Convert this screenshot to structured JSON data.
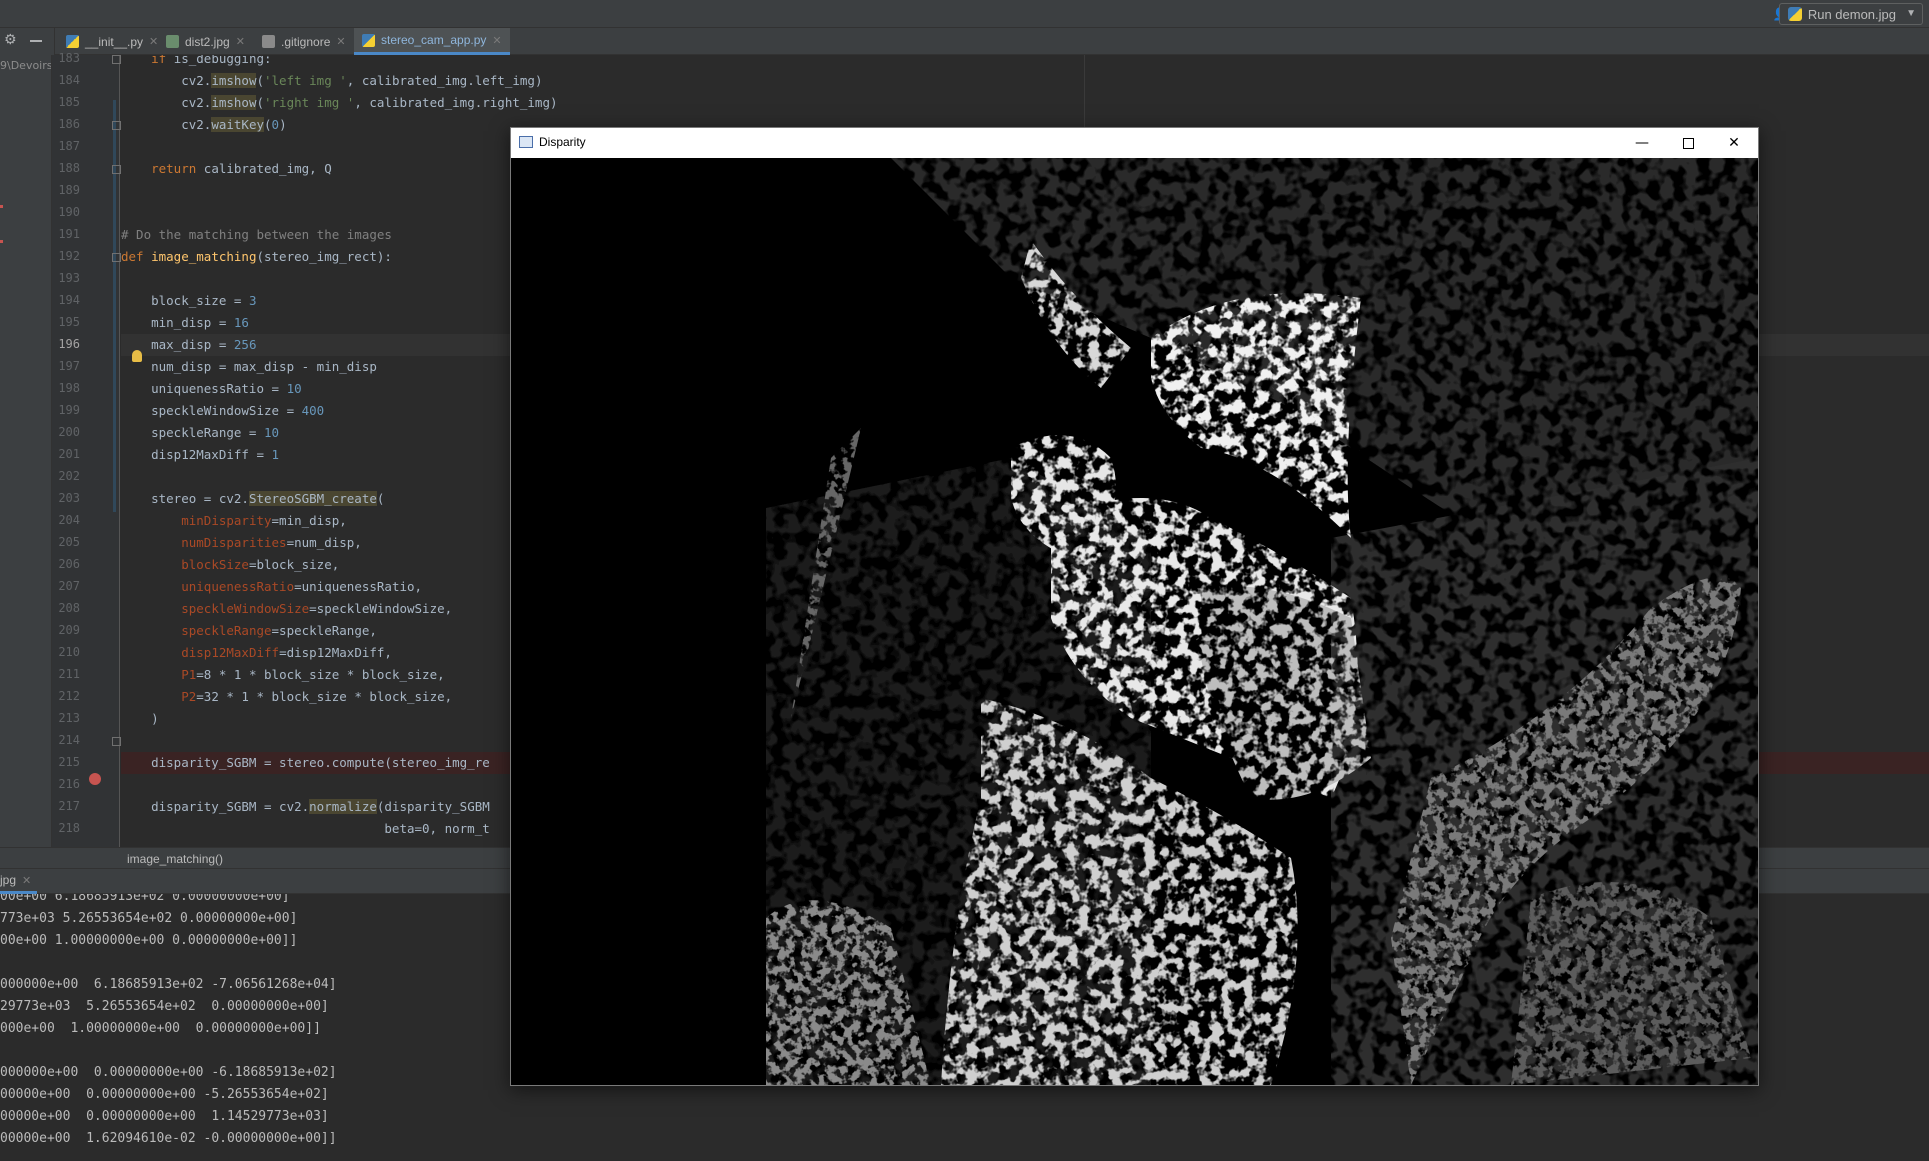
{
  "toolbar": {
    "run_config_label": "Run demon.jpg"
  },
  "tabs": [
    {
      "label": "__init__.py",
      "icon": "python-file-icon"
    },
    {
      "label": "dist2.jpg",
      "icon": "image-file-icon"
    },
    {
      "label": ".gitignore",
      "icon": "text-file-icon"
    },
    {
      "label": "stereo_cam_app.py",
      "icon": "python-file-icon",
      "active": true
    }
  ],
  "project_path_fragment": "9\\Devoirs",
  "editor": {
    "line_numbers": [
      "183",
      "184",
      "185",
      "186",
      "187",
      "188",
      "189",
      "190",
      "191",
      "192",
      "193",
      "194",
      "195",
      "196",
      "197",
      "198",
      "199",
      "200",
      "201",
      "202",
      "203",
      "204",
      "205",
      "206",
      "207",
      "208",
      "209",
      "210",
      "211",
      "212",
      "213",
      "214",
      "215",
      "216",
      "217",
      "218"
    ],
    "current_line": "196",
    "breakpoint_line": "215",
    "code_lines": [
      "    if is_debugging:",
      "        cv2.imshow('left img ', calibrated_img.left_img)",
      "        cv2.imshow('right img ', calibrated_img.right_img)",
      "        cv2.waitKey(0)",
      "",
      "    return calibrated_img, Q",
      "",
      "",
      "# Do the matching between the images",
      "def image_matching(stereo_img_rect):",
      "",
      "    block_size = 3",
      "    min_disp = 16",
      "    max_disp = 256",
      "    num_disp = max_disp - min_disp",
      "    uniquenessRatio = 10",
      "    speckleWindowSize = 400",
      "    speckleRange = 10",
      "    disp12MaxDiff = 1",
      "",
      "    stereo = cv2.StereoSGBM_create(",
      "        minDisparity=min_disp,",
      "        numDisparities=num_disp,",
      "        blockSize=block_size,",
      "        uniquenessRatio=uniquenessRatio,",
      "        speckleWindowSize=speckleWindowSize,",
      "        speckleRange=speckleRange,",
      "        disp12MaxDiff=disp12MaxDiff,",
      "        P1=8 * 1 * block_size * block_size,",
      "        P2=32 * 1 * block_size * block_size,",
      "    )",
      "",
      "    disparity_SGBM = stereo.compute(stereo_img_re",
      "",
      "    disparity_SGBM = cv2.normalize(disparity_SGBM",
      "                                   beta=0, norm_t"
    ]
  },
  "breadcrumb": "image_matching()",
  "run_panel": {
    "tab_label": "jpg",
    "output_lines": [
      "00e+00 6.18685913e+02 0.00000000e+00]",
      "773e+03 5.26553654e+02 0.00000000e+00]",
      "00e+00 1.00000000e+00 0.00000000e+00]]",
      "",
      "000000e+00  6.18685913e+02 -7.06561268e+04]",
      "29773e+03  5.26553654e+02  0.00000000e+00]",
      "000e+00  1.00000000e+00  0.00000000e+00]]",
      "",
      "000000e+00  0.00000000e+00 -6.18685913e+02]",
      "00000e+00  0.00000000e+00 -5.26553654e+02]",
      "00000e+00  0.00000000e+00  1.14529773e+03]",
      "00000e+00  1.62094610e-02 -0.00000000e+00]]"
    ]
  },
  "disparity_window": {
    "title": "Disparity",
    "controls": [
      "minimize",
      "maximize",
      "close"
    ]
  },
  "colors": {
    "ide_bg": "#2b2b2b",
    "panel_bg": "#3c3f41",
    "keyword": "#cc7832",
    "function": "#ffc66d",
    "string": "#6a8759",
    "number": "#6897bb",
    "comment": "#808080",
    "param": "#aa4926",
    "breakpoint": "#c75450",
    "accent": "#4a88c7"
  }
}
